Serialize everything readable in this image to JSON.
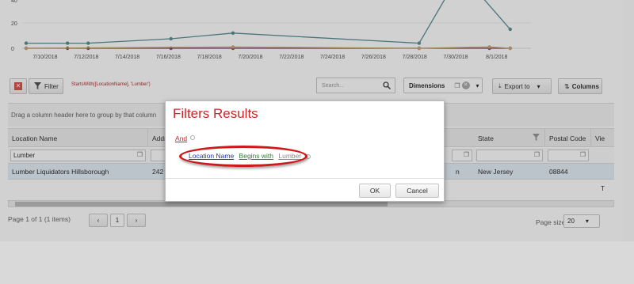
{
  "chart_data": {
    "type": "line",
    "x": [
      "7/10/2018",
      "7/12/2018",
      "7/14/2018",
      "7/16/2018",
      "7/18/2018",
      "7/20/2018",
      "7/22/2018",
      "7/24/2018",
      "7/26/2018",
      "7/28/2018",
      "7/30/2018",
      "8/1/2018"
    ],
    "y_ticks": [
      "20",
      "0"
    ],
    "y_top_partial": "40",
    "series": [
      {
        "color": "#5b8f94",
        "points": [
          [
            0,
            4
          ],
          [
            1,
            4
          ],
          [
            1.5,
            4
          ],
          [
            3.5,
            7.5
          ],
          [
            5,
            12
          ],
          [
            9.5,
            4
          ],
          [
            10.5,
            60
          ],
          [
            11.7,
            15
          ]
        ]
      },
      {
        "color": "#7a4a6a",
        "points": [
          [
            0,
            0
          ],
          [
            1,
            0
          ],
          [
            1.5,
            0
          ],
          [
            3.5,
            0
          ],
          [
            5,
            0
          ],
          [
            9.5,
            0
          ],
          [
            11.2,
            0
          ],
          [
            11.7,
            0
          ]
        ]
      },
      {
        "color": "#c8a87a",
        "points": [
          [
            0,
            0
          ],
          [
            5,
            1
          ],
          [
            9.5,
            0
          ],
          [
            11.2,
            1
          ],
          [
            11.7,
            0
          ]
        ]
      }
    ]
  },
  "toolbar": {
    "filter_label": "Filter",
    "filter_expression": "StartsWith([LocationName], 'Lumber')",
    "search_placeholder": "Search...",
    "dimensions_label": "Dimensions",
    "export_label": "Export to",
    "columns_label": "Columns"
  },
  "grid": {
    "group_hint": "Drag a column header here to group by that column",
    "columns": [
      "Location Name",
      "Addr",
      "State",
      "Postal Code",
      "Vie"
    ],
    "filter_values": [
      "Lumber"
    ],
    "row": {
      "name": "Lumber Liquidators Hillsborough",
      "addr": "242",
      "mid": "n",
      "state": "New Jersey",
      "postal": "08844"
    },
    "extra_cell": "T"
  },
  "pager": {
    "info": "Page 1 of 1 (1 items)",
    "page": "1",
    "prev": "‹",
    "next": "›",
    "size_label": "Page size:",
    "size_value": "20"
  },
  "dialog": {
    "title": "Filters Results",
    "group_op": "And",
    "condition": {
      "field": "Location Name",
      "operator": "Begins with",
      "value": "Lumber"
    },
    "ok_label": "OK",
    "cancel_label": "Cancel"
  }
}
